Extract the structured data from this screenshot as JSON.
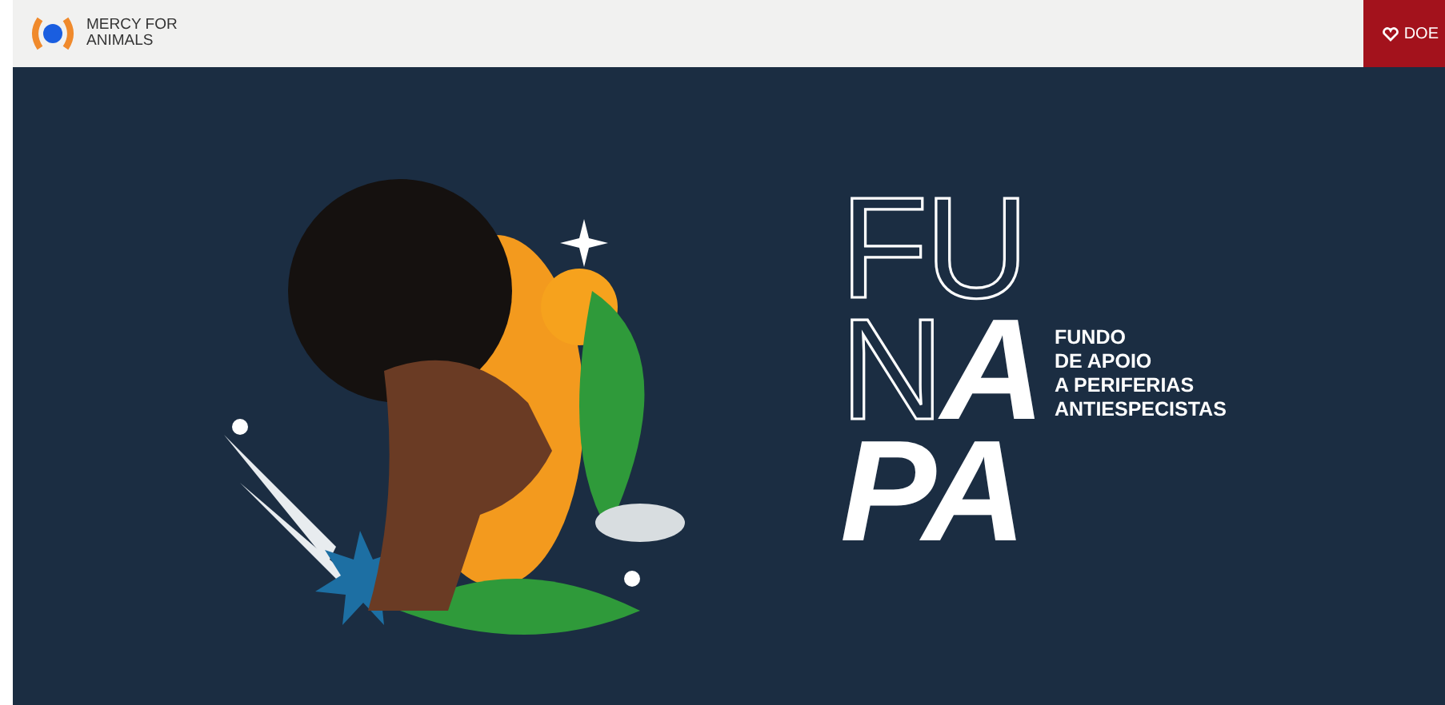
{
  "header": {
    "brand": [
      "MERCY FOR",
      "ANIMALS"
    ],
    "donate_button": "DOE"
  },
  "hero": {
    "logo_rows": [
      [
        {
          "text": "FU",
          "kind": "thin"
        }
      ],
      [
        {
          "text": "N",
          "kind": "thin"
        },
        {
          "text": "A",
          "kind": "bold"
        }
      ],
      [
        {
          "text": "PA",
          "kind": "bold"
        }
      ]
    ],
    "tagline": [
      "FUNDO",
      "DE APOIO",
      "A PERIFERIAS",
      "ANTIESPECISTAS"
    ]
  }
}
